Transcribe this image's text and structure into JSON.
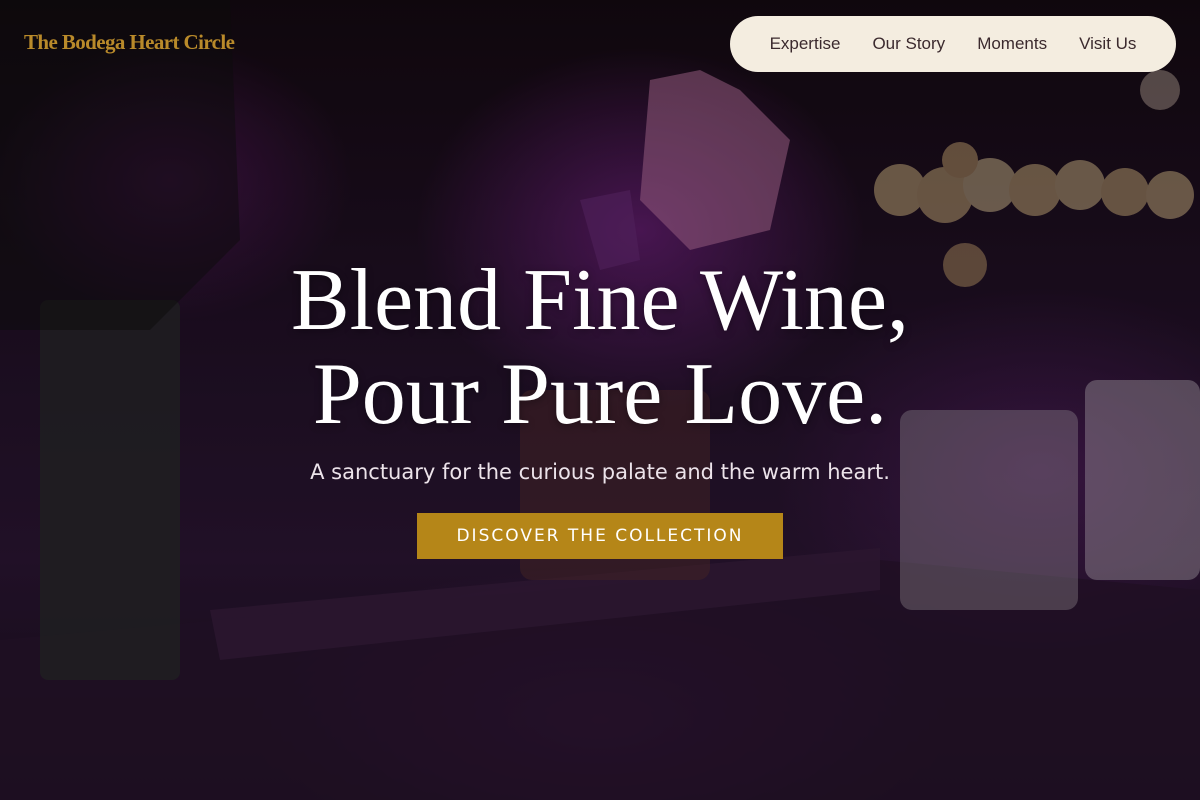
{
  "brand": {
    "name": "The Bodega Heart Circle",
    "color": "#b98a2a"
  },
  "nav": {
    "items": [
      {
        "label": "Expertise"
      },
      {
        "label": "Our Story"
      },
      {
        "label": "Moments"
      },
      {
        "label": "Visit Us"
      }
    ],
    "background": "#f4ede0"
  },
  "hero": {
    "headline_line1": "Blend Fine Wine,",
    "headline_line2": "Pour Pure Love.",
    "subtitle": "A sanctuary for the curious palate and the warm heart.",
    "cta_label": "DISCOVER THE COLLECTION",
    "cta_color": "#b58618",
    "background_image": "bartender-pouring-drink-photo"
  }
}
